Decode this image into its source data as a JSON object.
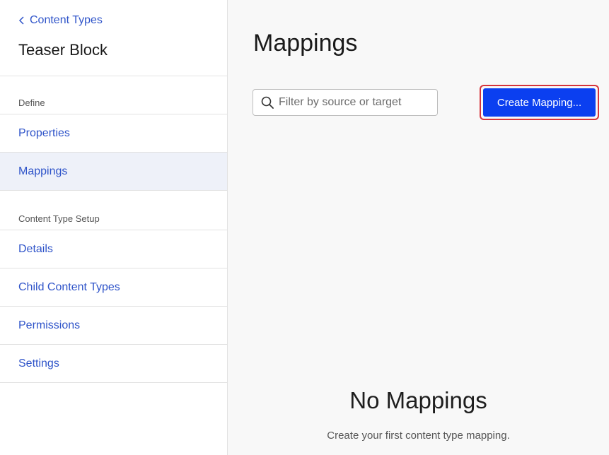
{
  "sidebar": {
    "back_label": "Content Types",
    "content_type_name": "Teaser Block",
    "groups": [
      {
        "label": "Define",
        "items": [
          "Properties",
          "Mappings"
        ]
      },
      {
        "label": "Content Type Setup",
        "items": [
          "Details",
          "Child Content Types",
          "Permissions",
          "Settings"
        ]
      }
    ],
    "active_item": "Mappings"
  },
  "main": {
    "title": "Mappings",
    "search": {
      "placeholder": "Filter by source or target",
      "value": ""
    },
    "create_button_label": "Create Mapping...",
    "empty_state": {
      "title": "No Mappings",
      "subtitle": "Create your first content type mapping."
    }
  },
  "colors": {
    "link": "#2f54c9",
    "primary_button": "#0b3ff0",
    "highlight_outline": "#d6333a",
    "active_nav_bg": "#eef1f9"
  },
  "icons": {
    "back": "chevron-left-icon",
    "search": "search-icon"
  }
}
